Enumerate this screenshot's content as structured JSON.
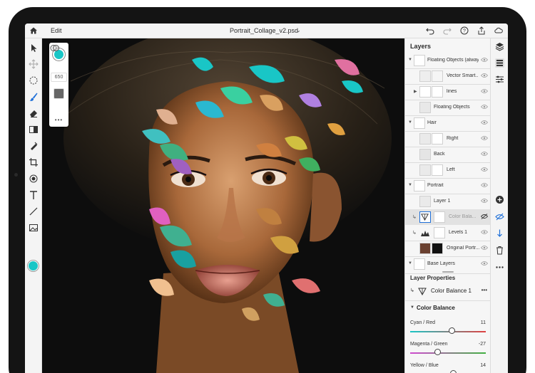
{
  "app": {
    "edit_label": "Edit",
    "doc_title": "Portrait_Collage_v2.psd",
    "accent_color": "#19c6c6"
  },
  "topbar_icons": [
    "home-icon",
    "undo-icon",
    "redo-icon",
    "help-icon",
    "share-icon",
    "cloud-icon"
  ],
  "toolbar": {
    "tools": [
      "move-icon",
      "transform-icon",
      "lasso-icon",
      "brush-icon",
      "eraser-icon",
      "gradient-icon",
      "healing-icon",
      "crop-icon",
      "fill-icon",
      "type-icon",
      "line-icon",
      "image-icon"
    ],
    "foreground_color": "#19c6c6"
  },
  "brush_panel": {
    "size": "650",
    "more": "•••"
  },
  "layers": {
    "title": "Layers",
    "items": [
      {
        "name": "Floating Objects (alway...",
        "indent": 0,
        "group": true
      },
      {
        "name": "Vector Smart...",
        "indent": 1,
        "group": false
      },
      {
        "name": "lines",
        "indent": 1,
        "group": true
      },
      {
        "name": "Floating Objects",
        "indent": 1,
        "group": false
      },
      {
        "name": "Hair",
        "indent": 0,
        "group": true
      },
      {
        "name": "Right",
        "indent": 1,
        "group": false
      },
      {
        "name": "Back",
        "indent": 1,
        "group": false
      },
      {
        "name": "Left",
        "indent": 1,
        "group": false
      },
      {
        "name": "Portrait",
        "indent": 0,
        "group": true
      },
      {
        "name": "Layer 1",
        "indent": 1,
        "group": false
      },
      {
        "name": "Color Bala...",
        "indent": 1,
        "group": false,
        "selected": true
      },
      {
        "name": "Levels 1",
        "indent": 1,
        "group": false
      },
      {
        "name": "Original Portr...",
        "indent": 1,
        "group": false
      },
      {
        "name": "Base Layers",
        "indent": 0,
        "group": true
      }
    ]
  },
  "properties": {
    "title": "Layer Properties",
    "layer_name": "Color Balance 1",
    "more": "•••",
    "section": "Color Balance",
    "sliders": [
      {
        "label": "Cyan / Red",
        "value": "11",
        "fraction": 0.555,
        "from": "#19c6c6",
        "to": "#e04040"
      },
      {
        "label": "Magenta / Green",
        "value": "-27",
        "fraction": 0.365,
        "from": "#d04ad0",
        "to": "#40b040"
      },
      {
        "label": "Yellow / Blue",
        "value": "14",
        "fraction": 0.57,
        "from": "#e0d020",
        "to": "#3050e0"
      }
    ]
  },
  "rail_icons": [
    "layers-icon",
    "layer-stack-icon",
    "adjust-icon",
    "add-layer-icon",
    "visibility-icon",
    "merge-icon",
    "delete-icon",
    "more-icon"
  ]
}
